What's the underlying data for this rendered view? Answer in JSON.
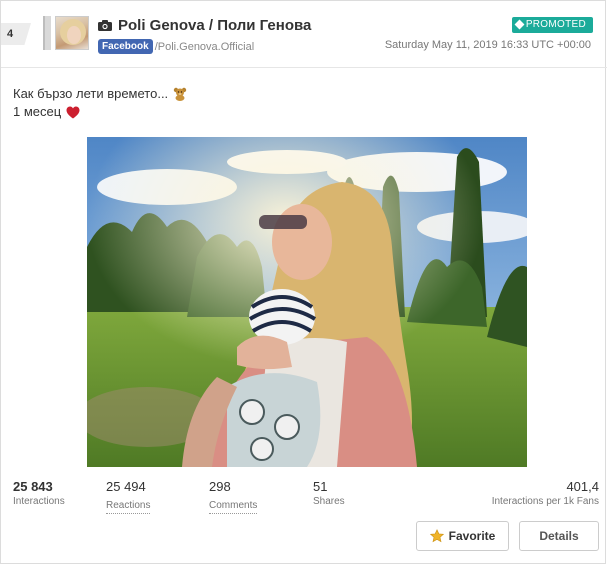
{
  "post": {
    "rank": "4",
    "page_name": "Poli Genova / Поли Генова",
    "platform": "Facebook",
    "handle": "/Poli.Genova.Official",
    "badge": "PROMOTED",
    "timestamp": "Saturday May 11, 2019 16:33 UTC +00:00",
    "text_line_1": "Как бързо лети времето...",
    "text_line_2": "1 месец"
  },
  "icons": {
    "camera": "camera-icon",
    "bear": "teddy-bear-emoji",
    "heart": "red-heart-emoji",
    "star": "star-icon"
  },
  "stats": {
    "interactions": {
      "value": "25 843",
      "label": "Interactions"
    },
    "reactions": {
      "value": "25 494",
      "label": "Reactions"
    },
    "comments": {
      "value": "298",
      "label": "Comments"
    },
    "shares": {
      "value": "51",
      "label": "Shares"
    },
    "per_fans": {
      "value": "401,4",
      "label": "Interactions per 1k Fans"
    }
  },
  "buttons": {
    "favorite": "Favorite",
    "details": "Details"
  },
  "colors": {
    "promoted": "#1bab9a",
    "facebook": "#4267b2",
    "star": "#f0b429",
    "heart": "#cc1f2f"
  }
}
